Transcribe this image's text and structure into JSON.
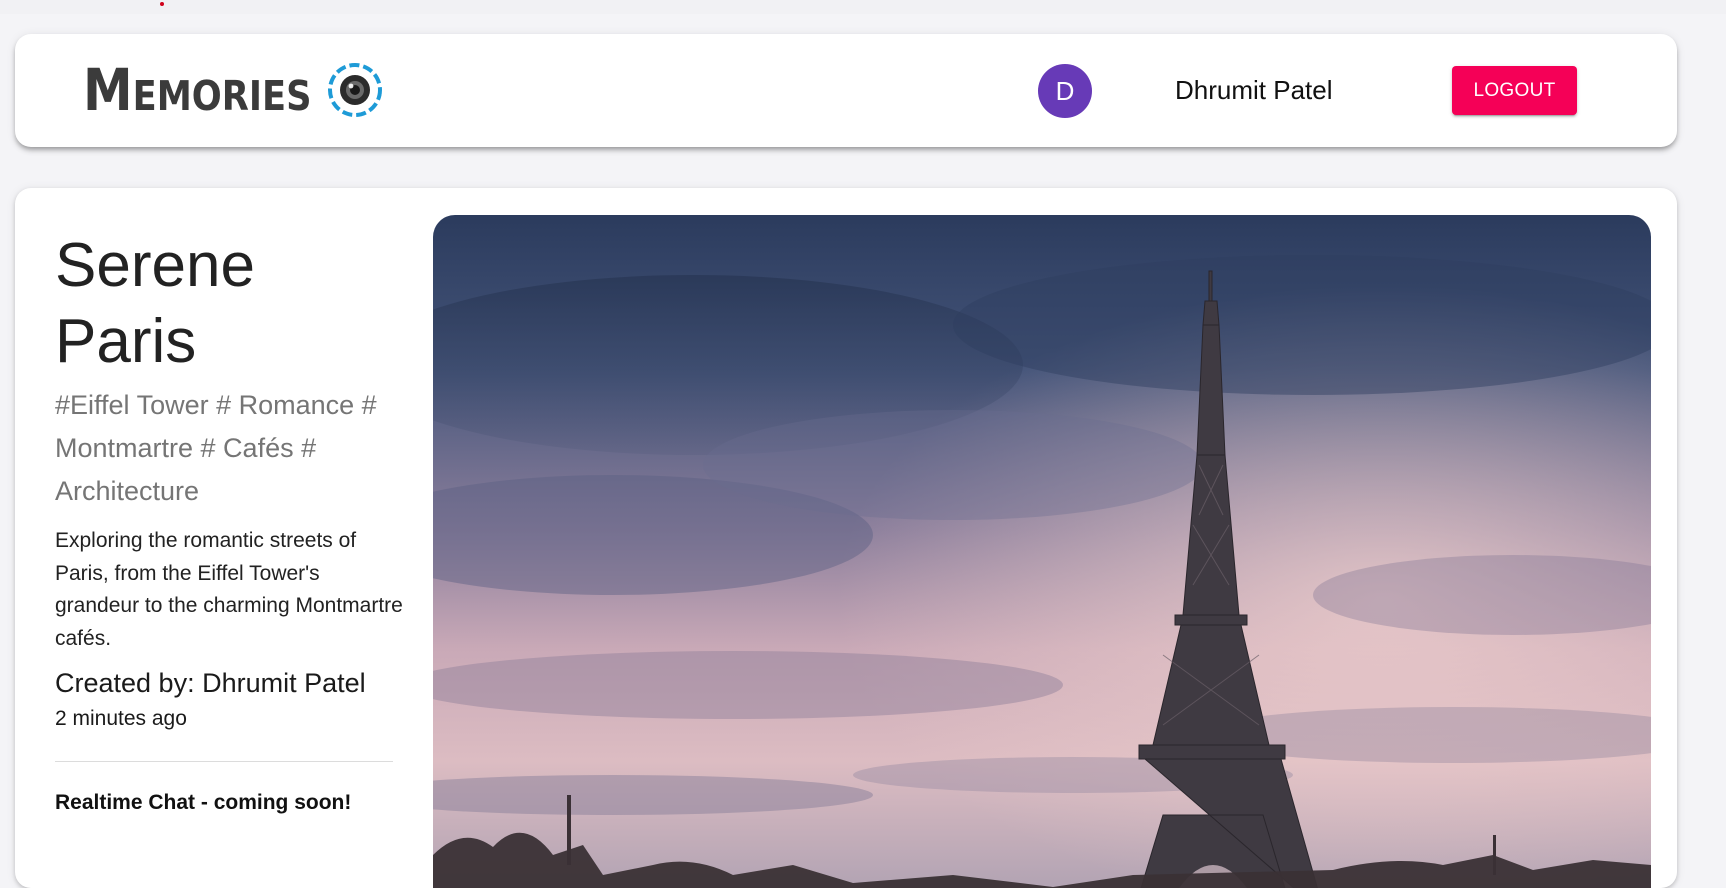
{
  "header": {
    "brand_text": "Memories",
    "brand_icon": "camera-lens-icon",
    "avatar_initial": "D",
    "user_name": "Dhrumit Patel",
    "logout_label": "LOGOUT"
  },
  "post": {
    "title": "Serene Paris",
    "tags": "#Eiffel Tower # Romance # Montmartre # Cafés # Architecture",
    "description": "Exploring the romantic streets of Paris, from the Eiffel Tower's grandeur to the charming Montmartre cafés.",
    "created_by": "Created by: Dhrumit Patel",
    "time_ago": "2 minutes ago",
    "chat_notice": "Realtime Chat - coming soon!",
    "image_subject": "eiffel-tower-photo"
  },
  "colors": {
    "avatar_bg": "#673ab7",
    "logout_bg": "#f50057",
    "brand_text": "#3b3b3b",
    "brand_icon_ring": "#1e9bd7",
    "tags_text": "#757575"
  }
}
